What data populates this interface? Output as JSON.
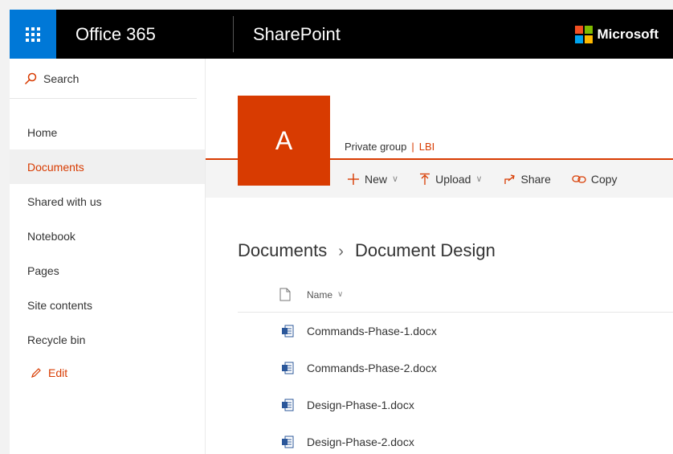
{
  "suite": {
    "brand": "Office 365",
    "app": "SharePoint",
    "vendor": "Microsoft"
  },
  "colors": {
    "accent": "#d83b01",
    "waffle": "#0078d7",
    "suitebar": "#000000"
  },
  "nav": {
    "search_label": "Search",
    "items": [
      {
        "label": "Home",
        "selected": false
      },
      {
        "label": "Documents",
        "selected": true
      },
      {
        "label": "Shared with us",
        "selected": false
      },
      {
        "label": "Notebook",
        "selected": false
      },
      {
        "label": "Pages",
        "selected": false
      },
      {
        "label": "Site contents",
        "selected": false
      },
      {
        "label": "Recycle bin",
        "selected": false
      }
    ],
    "edit_label": "Edit"
  },
  "site": {
    "logo_letter": "A",
    "privacy": "Private group",
    "classification": "LBI"
  },
  "commands": {
    "new": "New",
    "upload": "Upload",
    "share": "Share",
    "copy": "Copy"
  },
  "breadcrumb": {
    "root": "Documents",
    "current": "Document Design"
  },
  "list": {
    "column_name": "Name",
    "files": [
      {
        "name": "Commands-Phase-1.docx"
      },
      {
        "name": "Commands-Phase-2.docx"
      },
      {
        "name": "Design-Phase-1.docx"
      },
      {
        "name": "Design-Phase-2.docx"
      }
    ]
  }
}
